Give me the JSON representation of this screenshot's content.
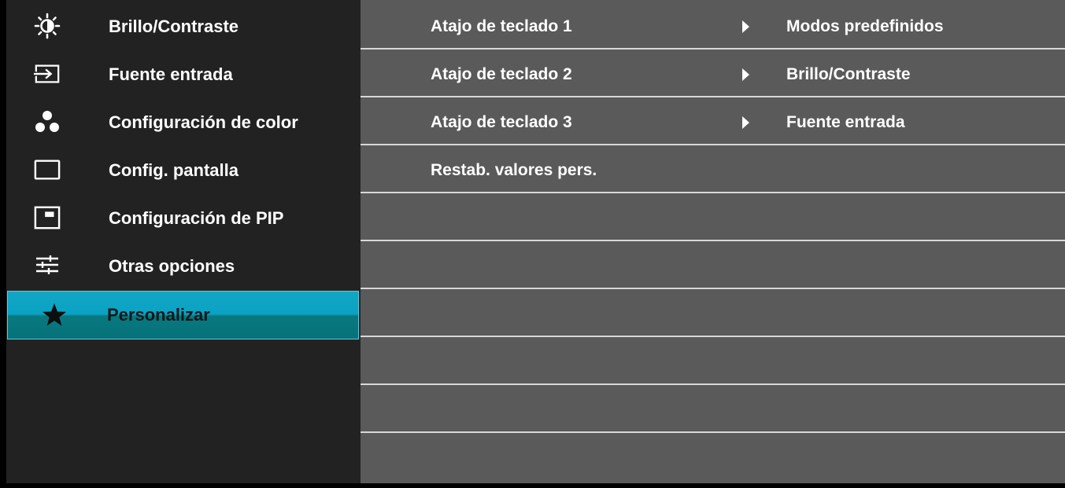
{
  "menu": {
    "items": [
      {
        "label": "Brillo/Contraste",
        "icon": "brightness-icon"
      },
      {
        "label": "Fuente entrada",
        "icon": "input-source-icon"
      },
      {
        "label": "Configuración de color",
        "icon": "color-settings-icon"
      },
      {
        "label": "Config. pantalla",
        "icon": "display-settings-icon"
      },
      {
        "label": "Configuración de PIP",
        "icon": "pip-icon"
      },
      {
        "label": "Otras opciones",
        "icon": "other-options-icon"
      },
      {
        "label": "Personalizar",
        "icon": "star-icon"
      }
    ],
    "selected_index": 6
  },
  "options": [
    {
      "label": "Atajo de teclado 1",
      "value": "Modos predefinidos"
    },
    {
      "label": "Atajo de teclado 2",
      "value": "Brillo/Contraste"
    },
    {
      "label": "Atajo de teclado 3",
      "value": "Fuente entrada"
    },
    {
      "label": "Restab. valores pers.",
      "value": ""
    }
  ],
  "colors": {
    "sidebar_bg": "#222222",
    "panel_bg": "#5a5a5a",
    "selection": "#0aa2c3",
    "divider": "#d8d8d8"
  }
}
